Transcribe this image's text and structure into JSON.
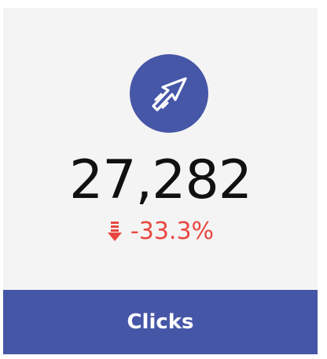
{
  "metric": {
    "icon": "cursor-click-icon",
    "value": "27,282",
    "change": "-33.3%",
    "change_direction": "down",
    "label": "Clicks"
  },
  "colors": {
    "accent": "#4657a8",
    "negative": "#e8473f",
    "card_background": "#f5f4f4"
  }
}
